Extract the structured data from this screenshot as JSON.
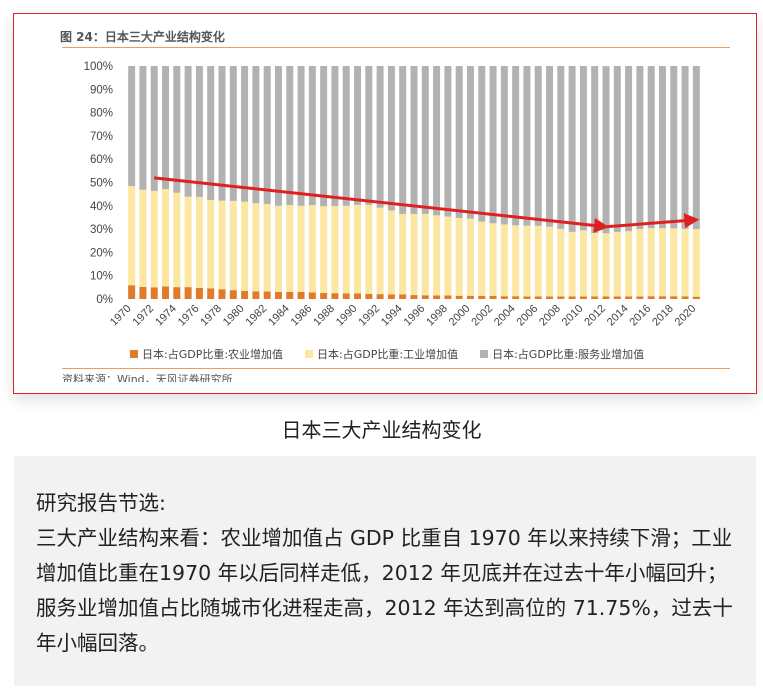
{
  "figure_title": "图 24：日本三大产业结构变化",
  "source_text": "资料来源：Wind，天风证券研究所",
  "caption": "日本三大产业结构变化",
  "summary": {
    "heading": "研究报告节选:",
    "body": "三大产业结构来看：农业增加值占 GDP 比重自 1970 年以来持续下滑；工业增加值比重在1970 年以后同样走低，2012 年见底并在过去十年小幅回升；服务业增加值占比随城市化进程走高，2012 年达到高位的 71.75%，过去十年小幅回落。"
  },
  "colors": {
    "agriculture": "#e07b2a",
    "industry": "#fbe7a1",
    "services": "#b2b2b2",
    "arrow": "#e02020",
    "frame": "#d9232e",
    "rule": "#e8a060"
  },
  "chart_data": {
    "type": "bar",
    "stacked": true,
    "title": "图 24：日本三大产业结构变化",
    "ylim": [
      0,
      100
    ],
    "yticks": [
      "0%",
      "10%",
      "20%",
      "30%",
      "40%",
      "50%",
      "60%",
      "70%",
      "80%",
      "90%",
      "100%"
    ],
    "xtick_labels": [
      "1970",
      "1972",
      "1974",
      "1976",
      "1978",
      "1980",
      "1982",
      "1984",
      "1986",
      "1988",
      "1990",
      "1992",
      "1994",
      "1996",
      "1998",
      "2000",
      "2002",
      "2004",
      "2006",
      "2008",
      "2010",
      "2012",
      "2014",
      "2016",
      "2018",
      "2020"
    ],
    "categories": [
      "1970",
      "1971",
      "1972",
      "1973",
      "1974",
      "1975",
      "1976",
      "1977",
      "1978",
      "1979",
      "1980",
      "1981",
      "1982",
      "1983",
      "1984",
      "1985",
      "1986",
      "1987",
      "1988",
      "1989",
      "1990",
      "1991",
      "1992",
      "1993",
      "1994",
      "1995",
      "1996",
      "1997",
      "1998",
      "1999",
      "2000",
      "2001",
      "2002",
      "2003",
      "2004",
      "2005",
      "2006",
      "2007",
      "2008",
      "2009",
      "2010",
      "2011",
      "2012",
      "2013",
      "2014",
      "2015",
      "2016",
      "2017",
      "2018",
      "2019",
      "2020"
    ],
    "series": [
      {
        "name": "日本:占GDP比重:农业增加值",
        "color": "#e07b2a",
        "values": [
          5.9,
          5.2,
          5.0,
          5.4,
          5.1,
          5.1,
          4.8,
          4.6,
          4.2,
          3.8,
          3.5,
          3.3,
          3.2,
          3.1,
          3.1,
          3.0,
          2.8,
          2.6,
          2.5,
          2.4,
          2.4,
          2.2,
          2.1,
          2.0,
          2.0,
          1.7,
          1.6,
          1.5,
          1.5,
          1.4,
          1.4,
          1.3,
          1.3,
          1.2,
          1.2,
          1.1,
          1.1,
          1.1,
          1.1,
          1.1,
          1.1,
          1.1,
          1.1,
          1.1,
          1.1,
          1.1,
          1.2,
          1.2,
          1.2,
          1.1,
          1.0
        ]
      },
      {
        "name": "日本:占GDP比重:工业增加值",
        "color": "#fbe7a1",
        "values": [
          42.6,
          41.7,
          41.4,
          41.8,
          40.5,
          38.8,
          39.0,
          37.9,
          38.0,
          38.3,
          38.3,
          37.8,
          37.6,
          36.9,
          37.2,
          37.0,
          37.5,
          37.2,
          37.4,
          37.6,
          38.0,
          38.2,
          37.1,
          36.0,
          34.5,
          34.8,
          34.9,
          34.4,
          33.9,
          33.4,
          33.1,
          31.9,
          31.2,
          30.8,
          30.4,
          30.4,
          30.3,
          29.9,
          29.0,
          27.7,
          28.4,
          27.2,
          27.1,
          27.7,
          28.0,
          28.9,
          29.2,
          29.2,
          29.1,
          29.0,
          29.0
        ]
      },
      {
        "name": "日本:占GDP比重:服务业增加值",
        "color": "#b2b2b2",
        "values": [
          51.5,
          53.1,
          53.6,
          52.8,
          54.4,
          56.1,
          56.2,
          57.5,
          57.8,
          57.9,
          58.2,
          58.9,
          59.2,
          60.0,
          59.7,
          60.0,
          59.7,
          60.2,
          60.1,
          60.0,
          59.6,
          59.6,
          60.8,
          62.0,
          63.5,
          63.5,
          63.5,
          64.1,
          64.6,
          65.2,
          65.5,
          66.8,
          67.5,
          68.0,
          68.4,
          68.5,
          68.6,
          69.0,
          69.9,
          71.2,
          70.5,
          71.7,
          71.75,
          71.2,
          70.9,
          70.0,
          69.6,
          69.6,
          69.7,
          69.9,
          70.0
        ]
      }
    ],
    "annotations": [
      {
        "type": "arrow",
        "from": [
          "1972",
          52
        ],
        "to": [
          "2012",
          31
        ]
      },
      {
        "type": "arrow",
        "from": [
          "2012",
          31
        ],
        "to": [
          "2020",
          34
        ]
      }
    ],
    "legend_position": "bottom"
  }
}
